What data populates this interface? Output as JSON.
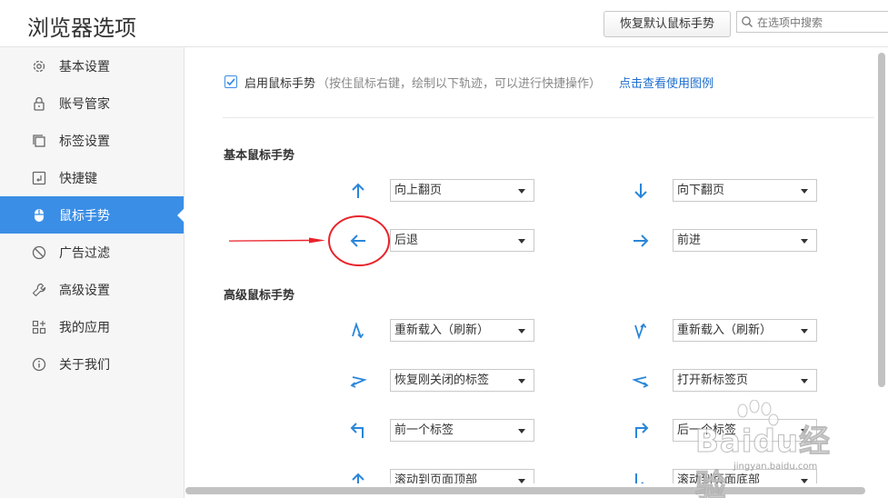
{
  "header": {
    "title": "浏览器选项",
    "restore_button": "恢复默认鼠标手势",
    "search_placeholder": "在选项中搜索"
  },
  "sidebar": {
    "items": [
      {
        "label": "基本设置",
        "icon": "gear-icon"
      },
      {
        "label": "账号管家",
        "icon": "lock-icon"
      },
      {
        "label": "标签设置",
        "icon": "tabs-icon"
      },
      {
        "label": "快捷键",
        "icon": "shortcut-icon"
      },
      {
        "label": "鼠标手势",
        "icon": "mouse-icon",
        "active": true
      },
      {
        "label": "广告过滤",
        "icon": "block-icon"
      },
      {
        "label": "高级设置",
        "icon": "wrench-icon"
      },
      {
        "label": "我的应用",
        "icon": "apps-icon"
      },
      {
        "label": "关于我们",
        "icon": "info-icon"
      }
    ]
  },
  "main": {
    "enable_label": "启用鼠标手势",
    "enable_hint": "（按住鼠标右键，绘制以下轨迹，可以进行快捷操作）",
    "enable_checked": true,
    "help_link": "点击查看使用图例",
    "basic_title": "基本鼠标手势",
    "advanced_title": "高级鼠标手势",
    "basic_gestures": [
      {
        "icon": "arrow-up-icon",
        "action": "向上翻页"
      },
      {
        "icon": "arrow-down-icon",
        "action": "向下翻页"
      },
      {
        "icon": "arrow-left-icon",
        "action": "后退"
      },
      {
        "icon": "arrow-right-icon",
        "action": "前进"
      }
    ],
    "advanced_gestures": [
      {
        "icon": "zigzag-up-down-icon",
        "action": "重新载入（刷新）"
      },
      {
        "icon": "zigzag-down-up-icon",
        "action": "重新载入（刷新）"
      },
      {
        "icon": "zigzag-right-left-icon",
        "action": "恢复刚关闭的标签"
      },
      {
        "icon": "zigzag-left-right-icon",
        "action": "打开新标签页"
      },
      {
        "icon": "turn-up-left-icon",
        "action": "前一个标签"
      },
      {
        "icon": "turn-up-right-icon",
        "action": "后一个标签"
      },
      {
        "icon": "up-to-top-icon",
        "action": "滚动到页面顶部"
      },
      {
        "icon": "down-to-bottom-icon",
        "action": "滚动到页面底部"
      }
    ]
  },
  "watermark": {
    "text": "Baidu经验",
    "url": "jingyan.baidu.com"
  },
  "colors": {
    "accent": "#3b8ee6",
    "link": "#1f6fcf",
    "annotation": "#e8232a"
  }
}
